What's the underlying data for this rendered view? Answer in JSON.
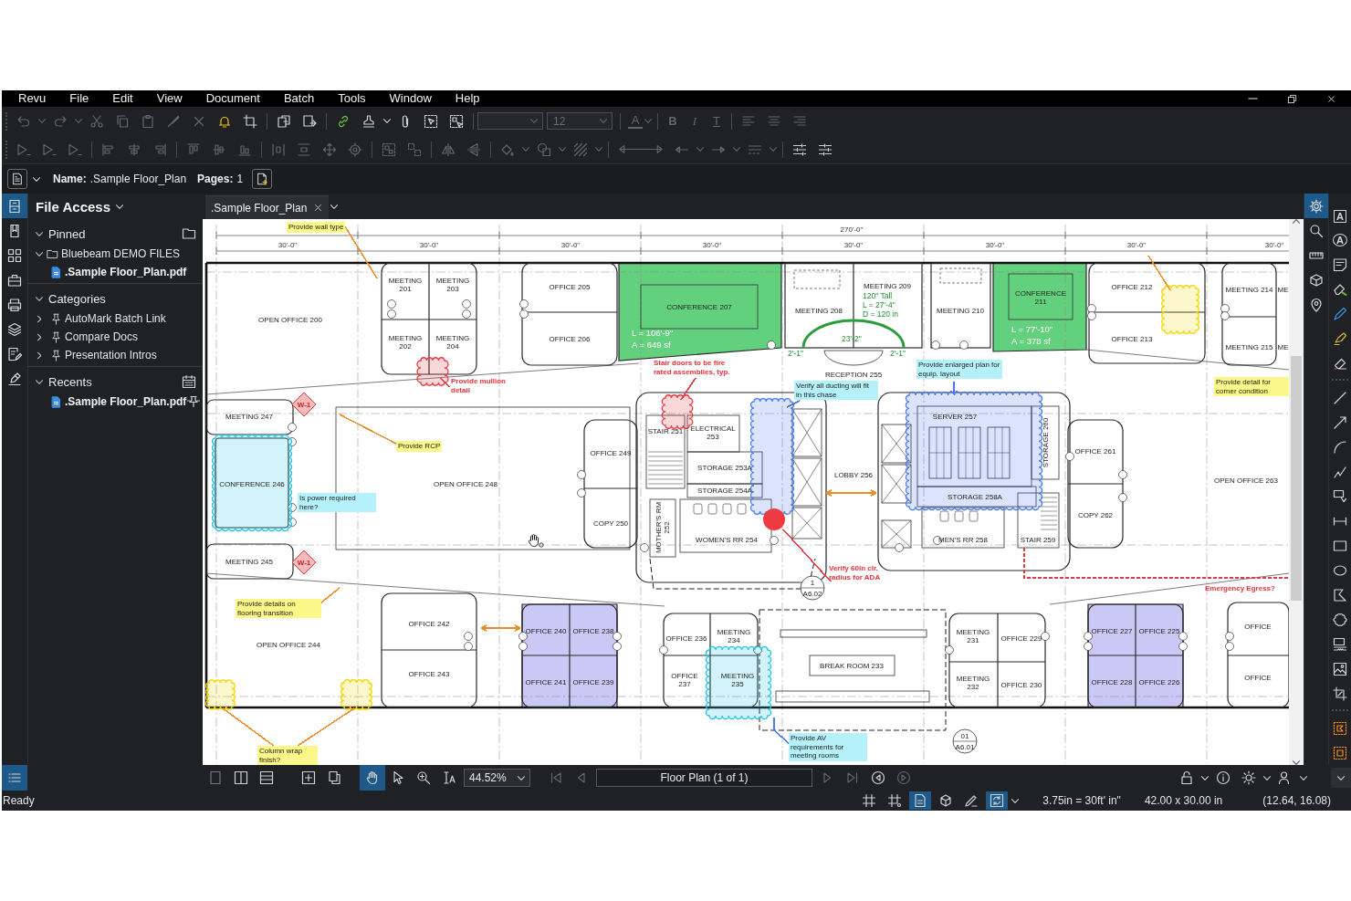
{
  "menu_bar": {
    "items": [
      "Revu",
      "File",
      "Edit",
      "View",
      "Document",
      "Batch",
      "Tools",
      "Window",
      "Help"
    ]
  },
  "format_bar": {
    "font_size": "12",
    "glyph_buttons": [
      "A",
      "B",
      "I",
      "T"
    ]
  },
  "document_info": {
    "name_label": "Name:",
    "name": ".Sample Floor_Plan",
    "pages_label": "Pages:",
    "pages": "1"
  },
  "left_tabs": [
    {
      "selected": true
    },
    {
      "selected": false
    },
    {
      "selected": false
    },
    {
      "selected": false
    },
    {
      "selected": false
    },
    {
      "selected": false
    },
    {
      "selected": false
    },
    {
      "selected": false
    }
  ],
  "left_panel": {
    "title": "File Access",
    "sections": [
      {
        "label": "Pinned",
        "kind": "pinned",
        "expanded": true,
        "children": [
          {
            "label": "Bluebeam DEMO FILES",
            "kind": "folder",
            "expanded": true,
            "children": [
              {
                "label": ".Sample Floor_Plan.pdf",
                "kind": "file"
              }
            ]
          }
        ]
      },
      {
        "label": "Categories",
        "kind": "categories",
        "expanded": true,
        "children": [
          {
            "label": "AutoMark Batch Link",
            "kind": "category",
            "expanded": false
          },
          {
            "label": "Compare Docs",
            "kind": "category",
            "expanded": false
          },
          {
            "label": "Presentation Intros",
            "kind": "category",
            "expanded": false
          }
        ]
      },
      {
        "label": "Recents",
        "kind": "recents",
        "expanded": true,
        "children": [
          {
            "label": ".Sample Floor_Plan.pdf",
            "kind": "recent"
          }
        ]
      }
    ]
  },
  "document_tabs": [
    {
      "label": ".Sample Floor_Plan",
      "selected": true
    }
  ],
  "drawing": {
    "overall_dimension": "270'-0\"",
    "bay_dimensions": [
      "30'-0\"",
      "30'-0\"",
      "30'-0\"",
      "30'-0\"",
      "30'-0\"",
      "30'-0\"",
      "30'-0\"",
      "30'-0\""
    ],
    "rooms": [
      "OPEN OFFICE 200",
      "MEETING 201",
      "MEETING 203",
      "MEETING 202",
      "MEETING 204",
      "OFFICE 205",
      "OFFICE 206",
      "CONFERENCE 207",
      "MEETING 208",
      "MEETING 209",
      "MEETING 210",
      "CONFERENCE 211",
      "OFFICE 212",
      "OFFICE 213",
      "MEETING 214",
      "MEETING 215",
      "ME",
      "ME",
      "RECEPTION 255",
      "MEETING 247",
      "CONFERENCE 246",
      "OPEN OFFICE 248",
      "OFFICE 249",
      "COPY 250",
      "STAIR 251",
      "ELECTRICAL 253",
      "STORAGE 253A",
      "STORAGE 254A",
      "MOTHER'S RM 252",
      "WOMEN'S RR 254",
      "LOBBY 256",
      "SERVER 257",
      "STORAGE 260",
      "STORAGE 258A",
      "MEN'S RR 258",
      "STAIR 259",
      "OFFICE 261",
      "COPY 262",
      "OPEN OFFICE 263",
      "MEETING 245",
      "OPEN OFFICE 244",
      "OFFICE 242",
      "OFFICE 243",
      "OFFICE 240",
      "OFFICE 238",
      "OFFICE 241",
      "OFFICE 239",
      "OFFICE 236",
      "MEETING 234",
      "OFFICE 237",
      "MEETING 235",
      "BREAK ROOM 233",
      "MEETING 231",
      "OFFICE 229",
      "MEETING 232",
      "OFFICE 230",
      "OFFICE 227",
      "OFFICE 225",
      "OFFICE 228",
      "OFFICE 226",
      "OFFICE",
      "OFFICE"
    ],
    "areas": [
      {
        "color": "#63d07e",
        "measurements": [
          "L = 106'-9\"",
          "A = 649 sf"
        ]
      },
      {
        "color": "#63d07e",
        "measurements": [
          "L = 77'-10\"",
          "A = 378 sf"
        ]
      },
      {
        "color": "#cbc8f6"
      },
      {
        "color": "#cbc8f6"
      }
    ],
    "arc_measurements": [
      "120\" Tall",
      "L = 27'-4\"",
      "D = 120 in",
      "23'-2\"",
      "2'-1\"",
      "2'-1\""
    ],
    "markups": [
      {
        "kind": "cloud",
        "color": "#22c3e6"
      },
      {
        "kind": "cloud",
        "color": "#22c3e6"
      },
      {
        "kind": "cloud",
        "color": "#4a78f0"
      },
      {
        "kind": "cloud",
        "color": "#4a78f0"
      },
      {
        "kind": "cloud",
        "color": "#f2d600"
      },
      {
        "kind": "cloud",
        "color": "#f2d600"
      },
      {
        "kind": "cloud",
        "color": "#f2d600"
      },
      {
        "kind": "cloud",
        "color": "#e53a40"
      },
      {
        "kind": "cloud",
        "color": "#e53a40"
      },
      {
        "kind": "circle",
        "color": "#ee3b42"
      },
      {
        "kind": "dashed",
        "color": "#e53a40"
      },
      {
        "kind": "dimension",
        "color": "#f08a24"
      },
      {
        "kind": "dimension",
        "color": "#f08a24"
      },
      {
        "kind": "leader",
        "color": "#f08a24"
      },
      {
        "kind": "leader",
        "color": "#e53a40"
      },
      {
        "kind": "leader",
        "color": "#e53a40"
      },
      {
        "kind": "leader",
        "color": "#4a78f0"
      },
      {
        "kind": "leader",
        "color": "#4a78f0"
      },
      {
        "kind": "leader",
        "color": "#f08a24"
      },
      {
        "kind": "leader",
        "color": "#f08a24"
      },
      {
        "kind": "leader",
        "color": "#e53a40"
      },
      {
        "kind": "leader",
        "color": "#f08a24"
      },
      {
        "kind": "leader",
        "color": "#4a78f0"
      },
      {
        "kind": "leader",
        "color": "#f08a24"
      },
      {
        "kind": "leader",
        "color": "#f08a24"
      }
    ],
    "notes": [
      {
        "text": "Provide wall type",
        "kind": "box",
        "color": "#fbf788"
      },
      {
        "text": "Provide mullion detail",
        "kind": "text",
        "color": "#e2333a"
      },
      {
        "text": "Stair doors to be fire rated assemblies, typ.",
        "kind": "text",
        "color": "#e2333a"
      },
      {
        "text": "Verify all ducting will fit in this chase",
        "kind": "box",
        "color": "#b5f1fa"
      },
      {
        "text": "Provide enlarged plan for equip. layout",
        "kind": "box",
        "color": "#b5f1fa"
      },
      {
        "text": "Provide detail for corner condition",
        "kind": "box",
        "color": "#fbf788"
      },
      {
        "text": "Provide RCP",
        "kind": "box",
        "color": "#fbf788"
      },
      {
        "text": "Is power required here?",
        "kind": "box",
        "color": "#b5f1fa"
      },
      {
        "text": "Verify 60in clr. radius for ADA",
        "kind": "text",
        "color": "#e2333a"
      },
      {
        "text": "Emergency Egress?",
        "kind": "text",
        "color": "#e2333a"
      },
      {
        "text": "Provide details on flooring transition",
        "kind": "box",
        "color": "#fbf788"
      },
      {
        "text": "Column wrap finish?",
        "kind": "box",
        "color": "#fbf788"
      },
      {
        "text": "Provide AV requirements for meeting rooms",
        "kind": "box",
        "color": "#b5f1fa"
      }
    ],
    "tags": [
      "W-1",
      "W-1"
    ],
    "section_marks": [
      {
        "number": "1",
        "sheet": "A6.02"
      },
      {
        "number": "01",
        "sheet": "A6.01"
      }
    ]
  },
  "right_tabs": [
    {
      "selected": true
    },
    {
      "selected": false
    },
    {
      "selected": false
    },
    {
      "selected": false
    },
    {
      "selected": false
    }
  ],
  "tools_panel": {
    "glyphs": [
      "A",
      "A"
    ]
  },
  "navigation": {
    "panel_toggle_selected": true,
    "tools": [
      {
        "selected": true
      },
      {
        "selected": false
      },
      {
        "selected": false
      },
      {
        "selected": false
      }
    ],
    "zoom": "44.52%",
    "page": "Floor Plan (1 of 1)"
  },
  "status_bar": {
    "text": "Ready",
    "toggles": [
      {
        "on": false
      },
      {
        "on": false
      },
      {
        "on": true
      },
      {
        "on": false
      },
      {
        "on": false
      },
      {
        "on": true
      }
    ],
    "scale": "3.75in = 30ft' in\"",
    "page_size": "42.00 x 30.00 in",
    "cursor": "(12.64, 16.08)"
  }
}
